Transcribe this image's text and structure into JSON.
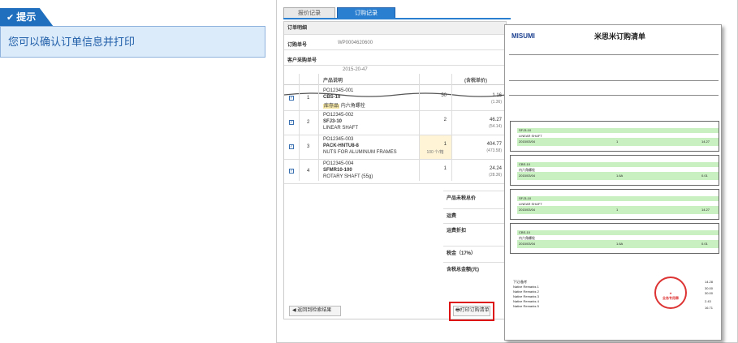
{
  "tip": {
    "title": "提示",
    "message": "您可以确认订单信息并打印"
  },
  "tabs": [
    {
      "label": "报价记录"
    },
    {
      "label": "订购记录"
    }
  ],
  "panel": {
    "header": "订单明细",
    "order_no_label": "订购单号",
    "order_no": "WP0004620600",
    "customer_no_label": "客户采购单号",
    "date_fragment": "2015-20-47"
  },
  "table": {
    "headers": [
      "产品说明",
      "(含税单价)"
    ],
    "rows": [
      {
        "no": "1",
        "code": "PO12345-001",
        "model": "CBS-10",
        "name": "内六角螺栓",
        "tag": "库存品",
        "qty": "50",
        "price": "1.16",
        "price_sub": "(1.36)"
      },
      {
        "no": "2",
        "code": "PO12345-002",
        "model": "SFJ3-10",
        "name": "LINEAR SHAFT",
        "qty": "2",
        "price": "46.27",
        "price_sub": "(54.14)"
      },
      {
        "no": "3",
        "code": "PO12345-003",
        "model": "PACK-HNTU8-8",
        "name": "NUTS FOR ALUMINUM FRAMES",
        "qty": "1",
        "qty_sub": "100 个/箱",
        "price": "404.77",
        "price_sub": "(473.58)"
      },
      {
        "no": "4",
        "code": "PO12345-004",
        "model": "SFMR10-100",
        "name": "ROTARY SHAFT (55g)",
        "qty": "1",
        "price": "24.24",
        "price_sub": "(28.36)"
      }
    ]
  },
  "summary": {
    "subtotal": "产品未税总价",
    "freight": "运费",
    "freight_discount": "运费折扣",
    "tax": "税金（17%）",
    "total": "含税总金额(元)"
  },
  "buttons": {
    "back": "返回到检索结果",
    "print": "打印订购清单"
  },
  "sheet": {
    "logo": "MISUMI",
    "title": "米思米订购清单",
    "products": [
      {
        "model": "SFJ3-10",
        "name": "LINEAR SHAFT",
        "date": "2015/03/04",
        "qty": "1",
        "amount": "14.27"
      },
      {
        "model": "CBS-10",
        "name": "内六角螺栓",
        "date": "2015/03/04",
        "qty": "1.6A",
        "amount": "0.01"
      },
      {
        "model": "SFJ3-10",
        "name": "LINEAR SHAFT",
        "date": "2015/03/04",
        "qty": "1",
        "amount": "14.27"
      },
      {
        "model": "CBS-10",
        "name": "内六角螺栓",
        "date": "2015/03/04",
        "qty": "1.6A",
        "amount": "0.01"
      }
    ],
    "remarks_label": "下记/备考",
    "remarks": [
      "Native Remarks 1",
      "Native Remarks 2",
      "Native Remarks 3",
      "Native Remarks 4",
      "Native Remarks 5"
    ],
    "totals": [
      "14.28",
      "30.00",
      "30.00",
      "2.43",
      "16.71"
    ],
    "stamp": "业务专用章"
  },
  "colors": {
    "accent": "#2a7fd0",
    "tip_bg": "#dcebfa",
    "highlight": "#d11111",
    "green": "#c8f0c0"
  }
}
